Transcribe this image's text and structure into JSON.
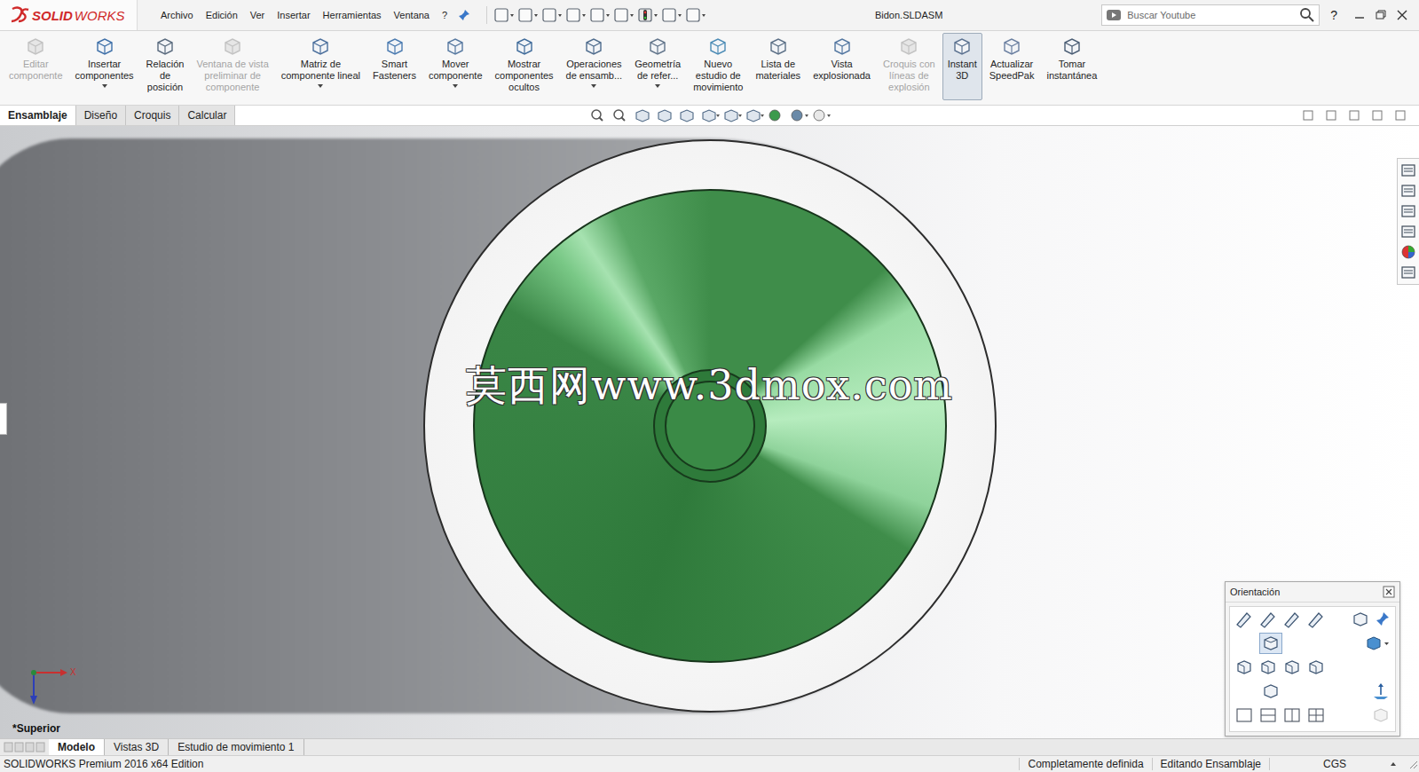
{
  "window": {
    "title": "Bidon.SLDASM"
  },
  "logo": {
    "strong": "SOLID",
    "light": "WORKS"
  },
  "menu": [
    {
      "label": "Archivo"
    },
    {
      "label": "Edición"
    },
    {
      "label": "Ver"
    },
    {
      "label": "Insertar"
    },
    {
      "label": "Herramientas"
    },
    {
      "label": "Ventana"
    },
    {
      "label": "?"
    }
  ],
  "search": {
    "placeholder": "Buscar Youtube"
  },
  "help": "?",
  "ribbon": [
    {
      "label": "Editar\ncomponente",
      "disabled": true,
      "selected": false,
      "dropdown": false
    },
    {
      "label": "Insertar\ncomponentes",
      "disabled": false,
      "selected": false,
      "dropdown": true
    },
    {
      "label": "Relación\nde\nposición",
      "disabled": false,
      "selected": false,
      "dropdown": false
    },
    {
      "label": "Ventana de vista\npreliminar de\ncomponente",
      "disabled": true,
      "selected": false,
      "dropdown": false
    },
    {
      "label": "Matriz de\ncomponente lineal",
      "disabled": false,
      "selected": false,
      "dropdown": true
    },
    {
      "label": "Smart\nFasteners",
      "disabled": false,
      "selected": false,
      "dropdown": false
    },
    {
      "label": "Mover\ncomponente",
      "disabled": false,
      "selected": false,
      "dropdown": true
    },
    {
      "label": "Mostrar\ncomponentes\nocultos",
      "disabled": false,
      "selected": false,
      "dropdown": false
    },
    {
      "label": "Operaciones\nde ensamb...",
      "disabled": false,
      "selected": false,
      "dropdown": true
    },
    {
      "label": "Geometría\nde refer...",
      "disabled": false,
      "selected": false,
      "dropdown": true
    },
    {
      "label": "Nuevo\nestudio de\nmovimiento",
      "disabled": false,
      "selected": false,
      "dropdown": false
    },
    {
      "label": "Lista de\nmateriales",
      "disabled": false,
      "selected": false,
      "dropdown": false
    },
    {
      "label": "Vista\nexplosionada",
      "disabled": false,
      "selected": false,
      "dropdown": false
    },
    {
      "label": "Croquis con\nlíneas de\nexplosión",
      "disabled": true,
      "selected": false,
      "dropdown": false
    },
    {
      "label": "Instant\n3D",
      "disabled": false,
      "selected": true,
      "dropdown": false
    },
    {
      "label": "Actualizar\nSpeedPak",
      "disabled": false,
      "selected": false,
      "dropdown": false
    },
    {
      "label": "Tomar\ninstantánea",
      "disabled": false,
      "selected": false,
      "dropdown": false
    }
  ],
  "command_tabs": [
    {
      "label": "Ensamblaje",
      "selected": true
    },
    {
      "label": "Diseño",
      "selected": false
    },
    {
      "label": "Croquis",
      "selected": false
    },
    {
      "label": "Calcular",
      "selected": false
    }
  ],
  "viewport": {
    "view_label": "*Superior",
    "axis_x": "X",
    "watermark": "莫西网www.3dmox.com"
  },
  "orientation_panel": {
    "title": "Orientación"
  },
  "bottom_tabs": [
    {
      "label": "Modelo",
      "selected": true
    },
    {
      "label": "Vistas 3D",
      "selected": false
    },
    {
      "label": "Estudio de movimiento 1",
      "selected": false
    }
  ],
  "status_bar": {
    "edition": "SOLIDWORKS Premium 2016 x64 Edition",
    "state": "Completamente definida",
    "mode": "Editando Ensamblaje",
    "units": "CGS"
  }
}
